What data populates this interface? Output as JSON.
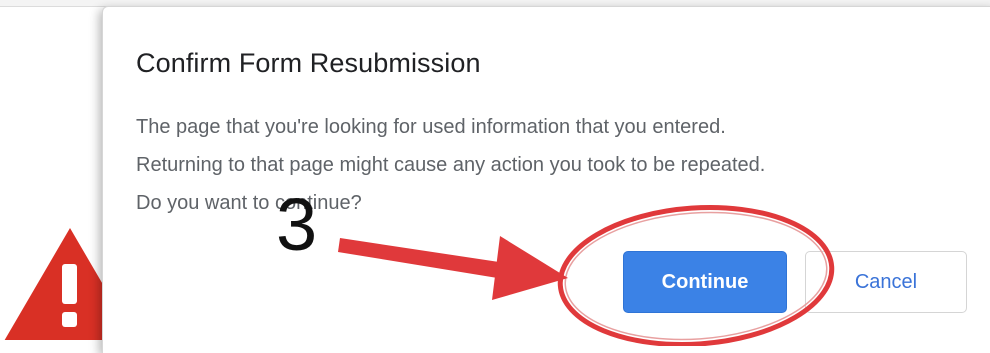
{
  "dialog": {
    "title": "Confirm Form Resubmission",
    "message_lines": [
      "The page that you're looking for used information that you entered.",
      "Returning to that page might cause any action you took to be repeated.",
      "Do you want to continue?"
    ],
    "continue_label": "Continue",
    "cancel_label": "Cancel"
  },
  "annotation": {
    "step_number": "3"
  },
  "icons": {
    "warning": "warning-triangle-icon"
  },
  "colors": {
    "primary_button": "#3b82e6",
    "cancel_text": "#3a73d8",
    "annotation_red": "#e0393b",
    "warning_red": "#d93025"
  }
}
